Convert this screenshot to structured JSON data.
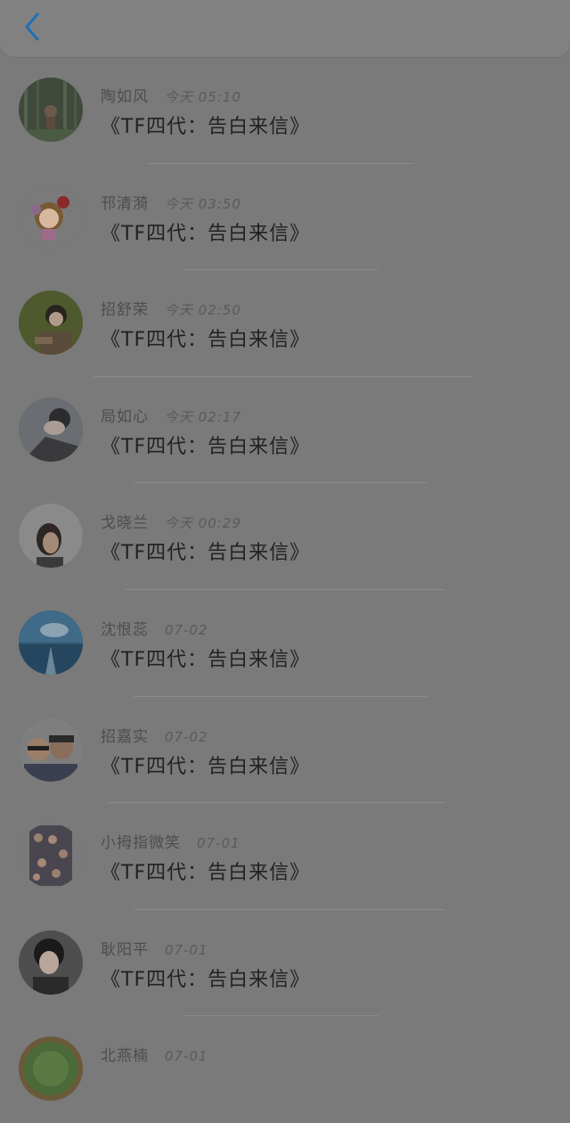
{
  "header": {
    "back_icon": "chevron-left-icon"
  },
  "colors": {
    "back_accent": "#1e6fb8",
    "overlay_bg": "#7a7a7a"
  },
  "messages": [
    {
      "name": "陶如风",
      "time": "今天 05:10",
      "title": "《TF四代：告白来信》",
      "avatar": "forest-photo"
    },
    {
      "name": "邗清漪",
      "time": "今天 03:50",
      "title": "《TF四代：告白来信》",
      "avatar": "cartoon-girl"
    },
    {
      "name": "招舒荣",
      "time": "今天 02:50",
      "title": "《TF四代：告白来信》",
      "avatar": "boy-photo"
    },
    {
      "name": "局如心",
      "time": "今天 02:17",
      "title": "《TF四代：告白来信》",
      "avatar": "sleeping-boy"
    },
    {
      "name": "戈晓兰",
      "time": "今天 00:29",
      "title": "《TF四代：告白来信》",
      "avatar": "woman-photo"
    },
    {
      "name": "沈恨蕊",
      "time": "07-02",
      "title": "《TF四代：告白来信》",
      "avatar": "sky-sea"
    },
    {
      "name": "招嘉实",
      "time": "07-02",
      "title": "《TF四代：告白来信》",
      "avatar": "selfie-pair"
    },
    {
      "name": "小拇指微笑",
      "time": "07-01",
      "title": "《TF四代：告白来信》",
      "avatar": "photo-collage"
    },
    {
      "name": "耿阳平",
      "time": "07-01",
      "title": "《TF四代：告白来信》",
      "avatar": "boy-hat"
    },
    {
      "name": "北燕楠",
      "time": "07-01",
      "title": "",
      "avatar": "green-round"
    }
  ]
}
